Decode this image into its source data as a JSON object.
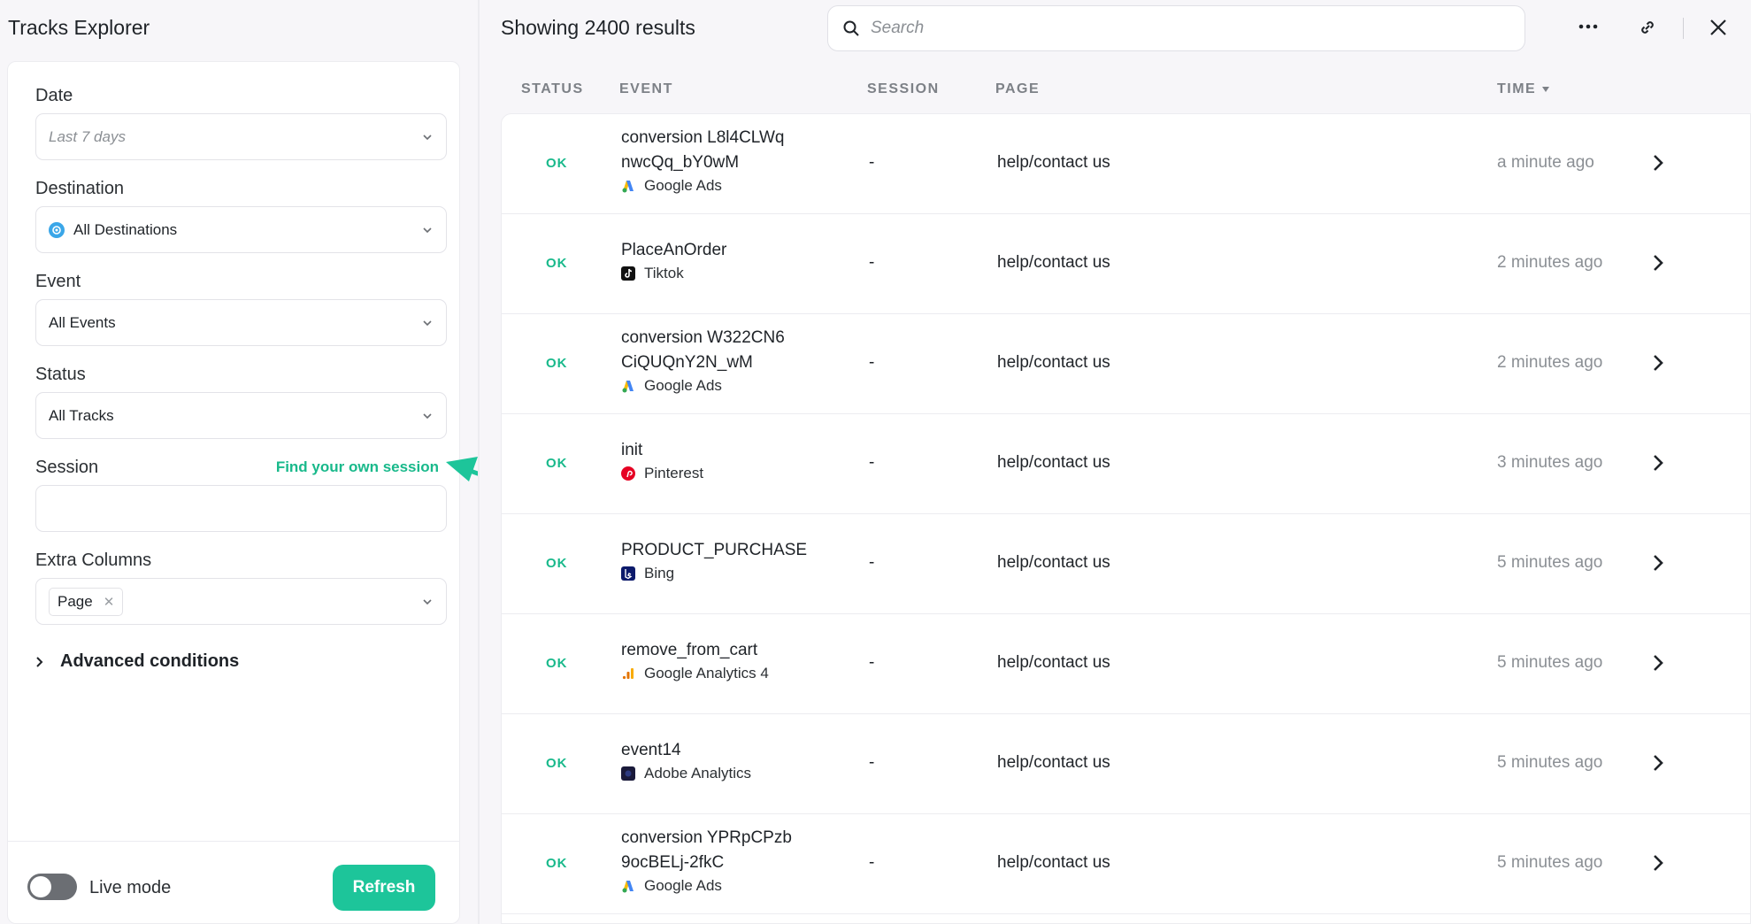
{
  "app": {
    "title": "Tracks Explorer"
  },
  "filters": {
    "date": {
      "label": "Date",
      "value": "Last 7 days"
    },
    "destination": {
      "label": "Destination",
      "value": "All Destinations"
    },
    "event": {
      "label": "Event",
      "value": "All Events"
    },
    "status": {
      "label": "Status",
      "value": "All Tracks"
    },
    "session": {
      "label": "Session",
      "link": "Find your own session",
      "value": ""
    },
    "extra_columns": {
      "label": "Extra Columns",
      "tag": "Page"
    },
    "advanced": "Advanced conditions",
    "live_mode": "Live mode",
    "refresh": "Refresh"
  },
  "results": {
    "title": "Showing 2400 results",
    "search_placeholder": "Search",
    "columns": {
      "status": "STATUS",
      "event": "EVENT",
      "session": "SESSION",
      "page": "PAGE",
      "time": "TIME"
    }
  },
  "rows": [
    {
      "status": "OK",
      "event": "conversion L8l4CLWqnwcQq_bY0wM",
      "destination": "Google Ads",
      "dest_icon": "google-ads",
      "session": "-",
      "page": "help/contact us",
      "time": "a minute ago"
    },
    {
      "status": "OK",
      "event": "PlaceAnOrder",
      "destination": "Tiktok",
      "dest_icon": "tiktok",
      "session": "-",
      "page": "help/contact us",
      "time": "2 minutes ago"
    },
    {
      "status": "OK",
      "event": "conversion W322CN6CiQUQnY2N_wM",
      "destination": "Google Ads",
      "dest_icon": "google-ads",
      "session": "-",
      "page": "help/contact us",
      "time": "2 minutes ago"
    },
    {
      "status": "OK",
      "event": "init",
      "destination": "Pinterest",
      "dest_icon": "pinterest",
      "session": "-",
      "page": "help/contact us",
      "time": "3 minutes ago"
    },
    {
      "status": "OK",
      "event": "PRODUCT_PURCHASE",
      "destination": "Bing",
      "dest_icon": "bing",
      "session": "-",
      "page": "help/contact us",
      "time": "5 minutes ago"
    },
    {
      "status": "OK",
      "event": "remove_from_cart",
      "destination": "Google Analytics 4",
      "dest_icon": "google-analytics",
      "session": "-",
      "page": "help/contact us",
      "time": "5 minutes ago"
    },
    {
      "status": "OK",
      "event": "event14",
      "destination": "Adobe Analytics",
      "dest_icon": "adobe-analytics",
      "session": "-",
      "page": "help/contact us",
      "time": "5 minutes ago"
    },
    {
      "status": "OK",
      "event": "conversion YPRpCPzb9ocBELj-2fkC",
      "destination": "Google Ads",
      "dest_icon": "google-ads",
      "session": "-",
      "page": "help/contact us",
      "time": "5 minutes ago"
    }
  ],
  "colors": {
    "accent": "#1dc59a",
    "ok": "#19b98b",
    "muted": "#8b8f94"
  }
}
